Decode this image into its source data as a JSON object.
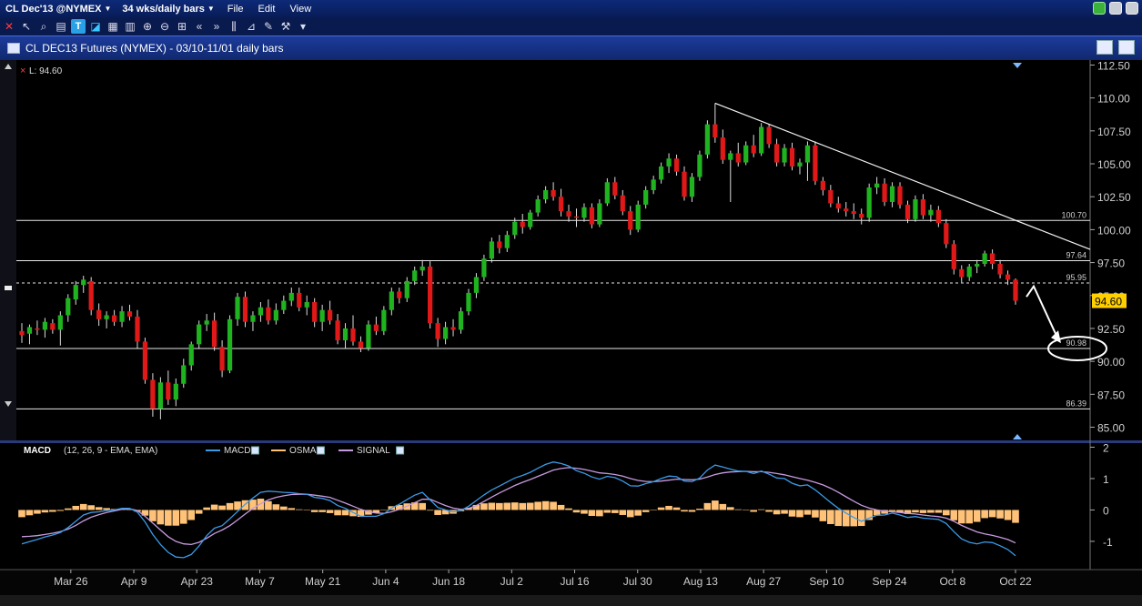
{
  "titlebar": {
    "symbol": "CL Dec'13 @NYMEX",
    "period": "34 wks/daily bars",
    "menus": [
      "File",
      "Edit",
      "View"
    ]
  },
  "header": {
    "title": "CL DEC13 Futures (NYMEX) - 03/10-11/01 daily bars"
  },
  "colors": {
    "up": "#1fb31f",
    "down": "#e01818",
    "macd": "#3a9ae6",
    "signal": "#c79adf",
    "osma": "#ffc278",
    "current_price_tag": "#ffd000",
    "axis_text": "#cfcfcf"
  },
  "chart_data": [
    {
      "type": "candlestick",
      "title": "CL DEC13 Futures (NYMEX) - 03/10-11/01 daily bars",
      "last_label": "L: 94.60",
      "price_axis": {
        "min": 84.0,
        "max": 112.6,
        "ticks": [
          "112.50",
          "110.00",
          "107.50",
          "105.00",
          "102.50",
          "100.00",
          "97.50",
          "95.00",
          "92.50",
          "90.00",
          "87.50",
          "85.00"
        ]
      },
      "date_ticks": [
        "Mar 26",
        "Apr 9",
        "Apr 23",
        "May 7",
        "May 21",
        "Jun 4",
        "Jun 18",
        "Jul 2",
        "Jul 16",
        "Jul 30",
        "Aug 13",
        "Aug 27",
        "Sep 10",
        "Sep 24",
        "Oct 8",
        "Oct 22"
      ],
      "horizontal_levels": [
        {
          "value": 100.7,
          "label": "100.70"
        },
        {
          "value": 97.64,
          "label": "97.64"
        },
        {
          "value": 95.95,
          "label": "95.95"
        },
        {
          "value": 90.98,
          "label": "90.98"
        },
        {
          "value": 86.39,
          "label": "86.39"
        }
      ],
      "current_price": {
        "value": 94.6,
        "label": "94.60"
      },
      "trendline": {
        "from": {
          "date": "Aug 28",
          "price": 109.6
        },
        "to": {
          "date": "Nov 01",
          "price": 98.5
        }
      },
      "forecast_arrow": {
        "from_price": 94.9,
        "peak_price": 95.7,
        "to_price": 91.8,
        "target": "90.98"
      },
      "bars": [
        [
          92.3,
          92.9,
          91.4,
          92.0
        ],
        [
          92.1,
          92.8,
          91.3,
          92.6
        ],
        [
          92.5,
          93.1,
          92.0,
          92.4
        ],
        [
          92.4,
          93.3,
          91.8,
          93.0
        ],
        [
          92.9,
          93.2,
          92.1,
          92.4
        ],
        [
          92.4,
          93.8,
          91.2,
          93.5
        ],
        [
          93.5,
          95.1,
          93.0,
          94.8
        ],
        [
          94.7,
          96.1,
          94.3,
          95.8
        ],
        [
          95.8,
          96.5,
          95.2,
          96.2
        ],
        [
          96.1,
          96.4,
          93.5,
          93.9
        ],
        [
          93.9,
          94.4,
          92.7,
          93.2
        ],
        [
          93.2,
          93.8,
          92.5,
          93.5
        ],
        [
          93.5,
          93.9,
          92.7,
          93.0
        ],
        [
          93.0,
          94.2,
          92.6,
          93.8
        ],
        [
          93.8,
          94.3,
          93.1,
          93.4
        ],
        [
          93.4,
          93.9,
          91.0,
          91.5
        ],
        [
          91.5,
          91.8,
          88.3,
          88.6
        ],
        [
          88.6,
          89.1,
          85.8,
          86.4
        ],
        [
          86.4,
          88.8,
          85.6,
          88.4
        ],
        [
          88.4,
          89.3,
          86.7,
          87.1
        ],
        [
          87.1,
          88.7,
          86.6,
          88.3
        ],
        [
          88.3,
          90.2,
          88.0,
          89.7
        ],
        [
          89.7,
          91.5,
          89.3,
          91.3
        ],
        [
          91.3,
          93.1,
          91.0,
          92.8
        ],
        [
          92.8,
          93.6,
          92.3,
          93.1
        ],
        [
          93.1,
          93.7,
          90.8,
          91.1
        ],
        [
          91.1,
          91.6,
          88.8,
          89.3
        ],
        [
          89.3,
          93.5,
          89.1,
          93.2
        ],
        [
          93.2,
          95.2,
          92.7,
          94.9
        ],
        [
          94.9,
          95.3,
          92.6,
          93.0
        ],
        [
          93.0,
          93.8,
          92.3,
          93.5
        ],
        [
          93.5,
          94.5,
          93.0,
          94.1
        ],
        [
          94.1,
          94.7,
          92.8,
          93.1
        ],
        [
          93.1,
          94.4,
          92.8,
          93.9
        ],
        [
          93.9,
          95.0,
          93.6,
          94.6
        ],
        [
          94.6,
          95.6,
          94.2,
          95.2
        ],
        [
          95.2,
          95.6,
          93.8,
          94.1
        ],
        [
          94.1,
          95.0,
          93.5,
          94.5
        ],
        [
          94.5,
          94.8,
          92.6,
          93.0
        ],
        [
          93.0,
          94.3,
          92.3,
          93.9
        ],
        [
          93.9,
          94.6,
          92.8,
          93.1
        ],
        [
          93.1,
          93.6,
          91.3,
          91.6
        ],
        [
          91.6,
          92.9,
          91.0,
          92.5
        ],
        [
          92.5,
          93.5,
          91.2,
          91.5
        ],
        [
          91.5,
          91.9,
          90.7,
          91.0
        ],
        [
          91.0,
          93.1,
          90.8,
          92.8
        ],
        [
          92.8,
          93.4,
          92.0,
          92.3
        ],
        [
          92.3,
          94.2,
          92.0,
          93.9
        ],
        [
          93.9,
          95.6,
          93.5,
          95.3
        ],
        [
          95.3,
          95.6,
          94.4,
          94.8
        ],
        [
          94.8,
          96.4,
          94.5,
          96.1
        ],
        [
          96.1,
          97.2,
          95.8,
          96.9
        ],
        [
          96.9,
          97.7,
          96.5,
          97.2
        ],
        [
          97.2,
          97.6,
          92.5,
          92.9
        ],
        [
          92.9,
          93.3,
          91.1,
          91.7
        ],
        [
          91.7,
          93.0,
          91.3,
          92.6
        ],
        [
          92.6,
          93.2,
          91.9,
          92.4
        ],
        [
          92.4,
          94.1,
          92.1,
          93.8
        ],
        [
          93.8,
          95.5,
          93.5,
          95.2
        ],
        [
          95.2,
          96.7,
          94.8,
          96.4
        ],
        [
          96.4,
          98.1,
          96.1,
          97.8
        ],
        [
          97.8,
          99.4,
          97.5,
          99.1
        ],
        [
          99.1,
          99.6,
          98.2,
          98.6
        ],
        [
          98.6,
          99.9,
          98.3,
          99.6
        ],
        [
          99.6,
          100.9,
          99.3,
          100.6
        ],
        [
          100.6,
          101.2,
          99.7,
          100.2
        ],
        [
          100.2,
          101.5,
          100.0,
          101.3
        ],
        [
          101.3,
          102.6,
          101.0,
          102.3
        ],
        [
          102.3,
          103.3,
          102.0,
          103.0
        ],
        [
          103.0,
          103.6,
          102.2,
          102.5
        ],
        [
          102.5,
          103.1,
          101.0,
          101.4
        ],
        [
          101.4,
          101.9,
          100.6,
          101.0
        ],
        [
          101.0,
          101.6,
          100.2,
          100.9
        ],
        [
          100.9,
          102.0,
          100.6,
          101.7
        ],
        [
          101.7,
          102.0,
          100.1,
          100.4
        ],
        [
          100.4,
          102.3,
          100.2,
          102.0
        ],
        [
          102.0,
          103.9,
          101.8,
          103.6
        ],
        [
          103.6,
          104.0,
          102.3,
          102.6
        ],
        [
          102.6,
          103.0,
          101.1,
          101.4
        ],
        [
          101.4,
          101.8,
          99.6,
          100.0
        ],
        [
          100.0,
          102.2,
          99.8,
          101.9
        ],
        [
          101.9,
          103.3,
          101.6,
          103.0
        ],
        [
          103.0,
          104.1,
          102.7,
          103.8
        ],
        [
          103.8,
          105.1,
          103.5,
          104.8
        ],
        [
          104.8,
          105.8,
          104.3,
          105.4
        ],
        [
          105.4,
          105.7,
          104.1,
          104.4
        ],
        [
          104.4,
          104.8,
          102.2,
          102.5
        ],
        [
          102.5,
          104.3,
          102.1,
          104.0
        ],
        [
          104.0,
          106.0,
          103.7,
          105.7
        ],
        [
          105.7,
          108.3,
          105.4,
          108.0
        ],
        [
          108.0,
          109.6,
          106.6,
          107.0
        ],
        [
          107.0,
          107.6,
          105.0,
          105.3
        ],
        [
          105.3,
          106.0,
          102.1,
          105.8
        ],
        [
          105.8,
          106.6,
          104.8,
          105.1
        ],
        [
          105.1,
          106.7,
          104.9,
          106.4
        ],
        [
          106.4,
          107.2,
          105.5,
          105.8
        ],
        [
          105.8,
          108.1,
          105.6,
          107.8
        ],
        [
          107.8,
          108.0,
          106.2,
          106.5
        ],
        [
          106.5,
          106.9,
          104.8,
          105.1
        ],
        [
          105.1,
          106.5,
          104.8,
          106.2
        ],
        [
          106.2,
          106.6,
          104.5,
          104.8
        ],
        [
          104.8,
          105.4,
          104.2,
          105.1
        ],
        [
          105.1,
          106.7,
          103.7,
          106.4
        ],
        [
          106.4,
          106.7,
          103.4,
          103.7
        ],
        [
          103.7,
          104.0,
          102.6,
          103.0
        ],
        [
          103.0,
          103.4,
          101.7,
          102.0
        ],
        [
          102.0,
          102.5,
          101.3,
          101.6
        ],
        [
          101.6,
          102.1,
          101.0,
          101.4
        ],
        [
          101.4,
          102.0,
          100.8,
          101.2
        ],
        [
          101.2,
          101.6,
          100.4,
          100.9
        ],
        [
          100.9,
          103.5,
          100.6,
          103.2
        ],
        [
          103.2,
          104.0,
          102.7,
          103.5
        ],
        [
          103.5,
          103.9,
          101.8,
          102.1
        ],
        [
          102.1,
          103.6,
          101.7,
          103.3
        ],
        [
          103.3,
          103.6,
          101.6,
          101.9
        ],
        [
          101.9,
          102.2,
          100.5,
          100.8
        ],
        [
          100.8,
          102.6,
          100.6,
          102.3
        ],
        [
          102.3,
          102.7,
          100.8,
          101.1
        ],
        [
          101.1,
          101.9,
          100.6,
          101.5
        ],
        [
          101.5,
          101.8,
          100.2,
          100.5
        ],
        [
          100.5,
          100.8,
          98.6,
          98.9
        ],
        [
          98.9,
          99.2,
          96.6,
          97.0
        ],
        [
          97.0,
          97.3,
          96.0,
          96.4
        ],
        [
          96.4,
          97.4,
          96.1,
          97.2
        ],
        [
          97.2,
          97.7,
          96.7,
          97.4
        ],
        [
          97.4,
          98.4,
          97.2,
          98.2
        ],
        [
          98.2,
          98.5,
          97.0,
          97.4
        ],
        [
          97.4,
          97.7,
          96.3,
          96.6
        ],
        [
          96.6,
          96.9,
          95.8,
          96.2
        ],
        [
          96.2,
          96.3,
          94.3,
          94.6
        ]
      ]
    },
    {
      "type": "macd",
      "params": "(12, 26, 9 - EMA, EMA)",
      "legend": [
        "MACD",
        "OSMA",
        "SIGNAL"
      ],
      "y_axis": {
        "min": -1.9,
        "max": 2.1,
        "ticks": [
          "2",
          "1",
          "0",
          "-1"
        ]
      },
      "macd": [
        -1.08,
        -1.01,
        -0.94,
        -0.86,
        -0.8,
        -0.72,
        -0.56,
        -0.36,
        -0.16,
        -0.08,
        -0.06,
        -0.02,
        0.0,
        0.05,
        0.05,
        -0.07,
        -0.38,
        -0.78,
        -1.1,
        -1.35,
        -1.5,
        -1.52,
        -1.42,
        -1.15,
        -0.82,
        -0.58,
        -0.5,
        -0.28,
        -0.05,
        0.18,
        0.38,
        0.56,
        0.6,
        0.58,
        0.56,
        0.55,
        0.52,
        0.5,
        0.4,
        0.37,
        0.3,
        0.14,
        0.05,
        -0.08,
        -0.2,
        -0.2,
        -0.2,
        -0.12,
        0.06,
        0.18,
        0.33,
        0.47,
        0.56,
        0.32,
        0.08,
        0.0,
        -0.06,
        -0.02,
        0.12,
        0.3,
        0.48,
        0.64,
        0.76,
        0.89,
        1.02,
        1.1,
        1.2,
        1.33,
        1.45,
        1.53,
        1.48,
        1.4,
        1.25,
        1.17,
        1.05,
        0.98,
        1.07,
        1.03,
        0.92,
        0.77,
        0.76,
        0.84,
        0.9,
        1.0,
        1.08,
        1.06,
        0.92,
        0.9,
        1.02,
        1.27,
        1.43,
        1.37,
        1.3,
        1.24,
        1.23,
        1.16,
        1.24,
        1.14,
        1.02,
        1.0,
        0.85,
        0.77,
        0.8,
        0.64,
        0.44,
        0.24,
        0.05,
        -0.1,
        -0.24,
        -0.36,
        -0.26,
        -0.17,
        -0.16,
        -0.1,
        -0.16,
        -0.24,
        -0.21,
        -0.26,
        -0.28,
        -0.3,
        -0.43,
        -0.69,
        -0.92,
        -1.03,
        -1.08,
        -1.02,
        -1.04,
        -1.14,
        -1.26,
        -1.46
      ],
      "signal": [
        -0.85,
        -0.84,
        -0.82,
        -0.78,
        -0.74,
        -0.69,
        -0.61,
        -0.49,
        -0.35,
        -0.23,
        -0.15,
        -0.08,
        -0.03,
        0.02,
        0.04,
        -0.02,
        -0.2,
        -0.42,
        -0.64,
        -0.85,
        -1.0,
        -1.08,
        -1.1,
        -1.03,
        -0.9,
        -0.75,
        -0.64,
        -0.5,
        -0.32,
        -0.13,
        0.05,
        0.2,
        0.32,
        0.4,
        0.45,
        0.49,
        0.5,
        0.5,
        0.47,
        0.44,
        0.4,
        0.31,
        0.22,
        0.12,
        0.02,
        -0.05,
        -0.1,
        -0.11,
        -0.06,
        0.02,
        0.12,
        0.23,
        0.34,
        0.34,
        0.24,
        0.14,
        0.06,
        0.02,
        0.05,
        0.14,
        0.27,
        0.41,
        0.54,
        0.66,
        0.78,
        0.88,
        0.97,
        1.07,
        1.17,
        1.27,
        1.32,
        1.35,
        1.33,
        1.29,
        1.24,
        1.18,
        1.16,
        1.13,
        1.08,
        1.0,
        0.94,
        0.91,
        0.9,
        0.92,
        0.95,
        0.98,
        0.97,
        0.96,
        0.98,
        1.05,
        1.13,
        1.18,
        1.21,
        1.22,
        1.23,
        1.22,
        1.22,
        1.2,
        1.16,
        1.12,
        1.06,
        1.0,
        0.95,
        0.88,
        0.8,
        0.69,
        0.56,
        0.42,
        0.28,
        0.15,
        0.06,
        0.0,
        -0.04,
        -0.06,
        -0.08,
        -0.11,
        -0.13,
        -0.16,
        -0.19,
        -0.21,
        -0.26,
        -0.36,
        -0.49,
        -0.6,
        -0.7,
        -0.76,
        -0.81,
        -0.87,
        -0.94,
        -1.05
      ]
    }
  ]
}
